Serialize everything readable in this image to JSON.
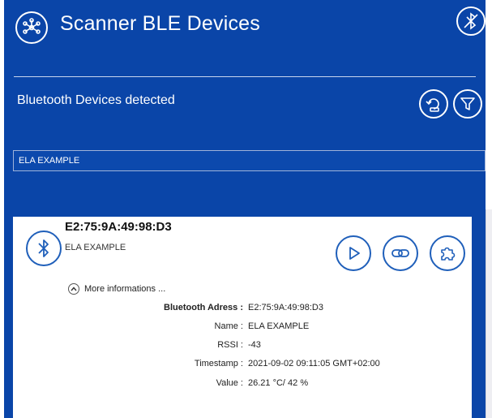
{
  "header": {
    "title": "Scanner BLE Devices",
    "app_icon": "network-nodes-icon",
    "close_icon": "bluetooth-off-icon"
  },
  "section": {
    "title": "Bluetooth Devices detected",
    "refresh_icon": "refresh-scan-icon",
    "filter_icon": "filter-icon"
  },
  "search": {
    "value": "ELA EXAMPLE"
  },
  "device": {
    "mac": "E2:75:9A:49:98:D3",
    "name": "ELA EXAMPLE",
    "more_label": "More informations ...",
    "actions": [
      "play-icon",
      "connect-link-icon",
      "puzzle-icon"
    ],
    "details": [
      {
        "key": "Bluetooth Adress :",
        "value": "E2:75:9A:49:98:D3"
      },
      {
        "key": "Name :",
        "value": "ELA EXAMPLE"
      },
      {
        "key": "RSSI :",
        "value": "-43"
      },
      {
        "key": "Timestamp :",
        "value": "2021-09-02 09:11:05 GMT+02:00"
      },
      {
        "key": "Value :",
        "value": "26.21 °C/ 42 %"
      }
    ]
  },
  "colors": {
    "primary": "#0a45a8",
    "card": "#ffffff",
    "accent": "#1f5fba"
  }
}
